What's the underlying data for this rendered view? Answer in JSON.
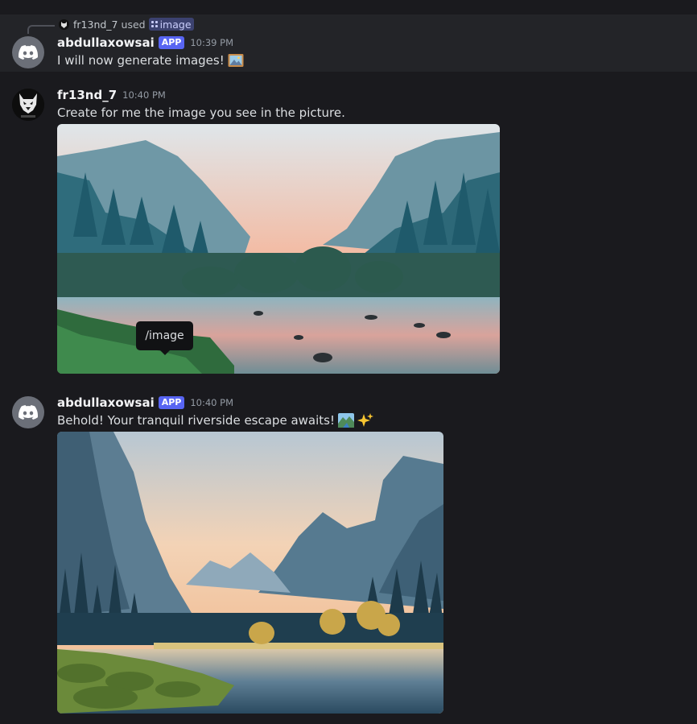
{
  "messages": [
    {
      "reply": {
        "user": "fr13nd_7",
        "action": "used",
        "command": "image"
      },
      "author": "abdullaxowsai",
      "badge": "APP",
      "time": "10:39 PM",
      "text": "I will now generate images!",
      "emoji": "framed-picture-emoji"
    },
    {
      "author": "fr13nd_7",
      "time": "10:40 PM",
      "text": "Create for me the image you see in the picture.",
      "attachment": {
        "subject": "river valley with forest and granite cliffs at sunrise"
      },
      "tooltip": "/image"
    },
    {
      "author": "abdullaxowsai",
      "badge": "APP",
      "time": "10:40 PM",
      "text": "Behold! Your tranquil riverside escape awaits!",
      "emojis": [
        "national-park-emoji",
        "sparkles-emoji"
      ],
      "attachment": {
        "subject": "illustrated valley with cliffs, pine forest and river reflection"
      }
    }
  ],
  "colors": {
    "background": "#1a1a1e",
    "highlight_row": "#232428",
    "app_badge": "#5865f2",
    "command_chip": "#3c4270"
  }
}
